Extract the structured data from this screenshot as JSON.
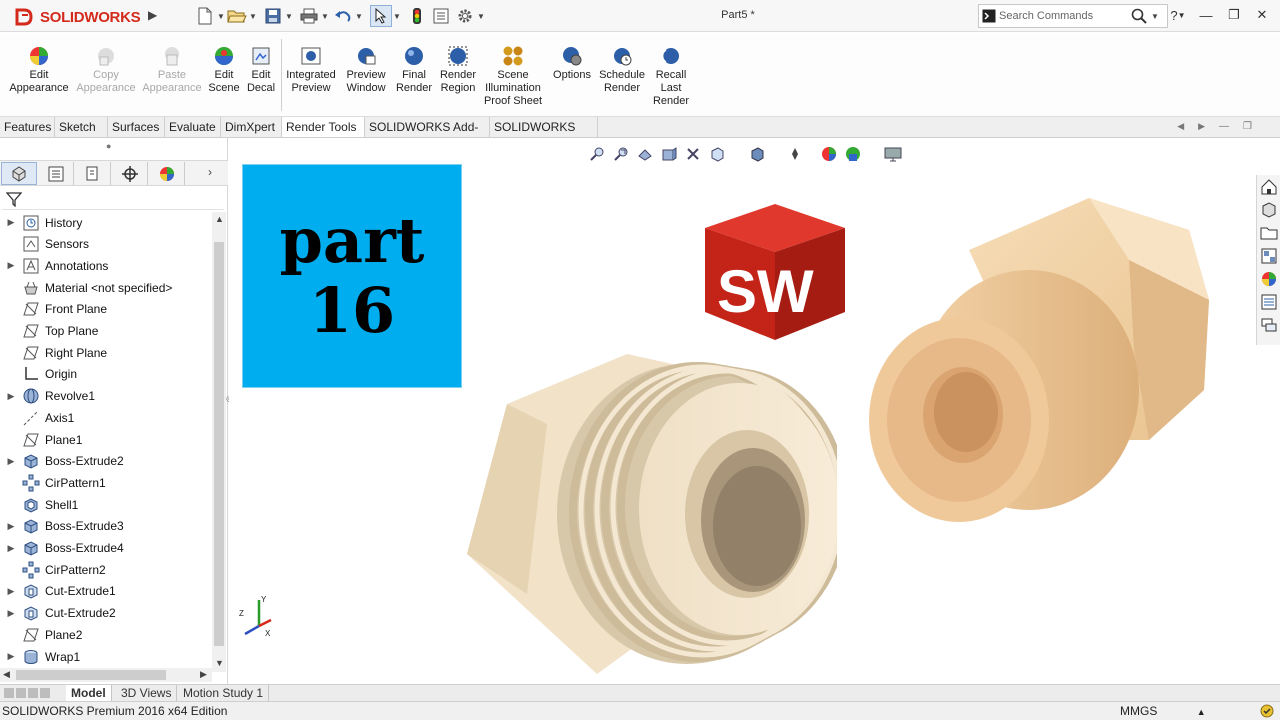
{
  "titlebar": {
    "app_name": "SOLIDWORKS",
    "doc_title": "Part5 *",
    "search_placeholder": "Search Commands",
    "help_label": "?",
    "min_label": "—",
    "restore_label": "❐",
    "close_label": "✕"
  },
  "commands": [
    {
      "l1": "Edit",
      "l2": "Appearance",
      "l3": "",
      "disabled": false
    },
    {
      "l1": "Copy",
      "l2": "Appearance",
      "l3": "",
      "disabled": true
    },
    {
      "l1": "Paste",
      "l2": "Appearance",
      "l3": "",
      "disabled": true
    },
    {
      "l1": "Edit",
      "l2": "Scene",
      "l3": "",
      "disabled": false
    },
    {
      "l1": "Edit",
      "l2": "Decal",
      "l3": "",
      "disabled": false
    },
    {
      "l1": "Integrated",
      "l2": "Preview",
      "l3": "",
      "disabled": false
    },
    {
      "l1": "Preview",
      "l2": "Window",
      "l3": "",
      "disabled": false
    },
    {
      "l1": "Final",
      "l2": "Render",
      "l3": "",
      "disabled": false
    },
    {
      "l1": "Render",
      "l2": "Region",
      "l3": "",
      "disabled": false
    },
    {
      "l1": "Scene",
      "l2": "Illumination",
      "l3": "Proof Sheet",
      "disabled": false
    },
    {
      "l1": "Options",
      "l2": "",
      "l3": "",
      "disabled": false
    },
    {
      "l1": "Schedule",
      "l2": "Render",
      "l3": "",
      "disabled": false
    },
    {
      "l1": "Recall",
      "l2": "Last",
      "l3": "Render",
      "disabled": false
    }
  ],
  "tabs": [
    "Features",
    "Sketch",
    "Surfaces",
    "Evaluate",
    "DimXpert",
    "Render Tools",
    "SOLIDWORKS Add-Ins",
    "SOLIDWORKS MBD"
  ],
  "active_tab": "Render Tools",
  "tree": [
    {
      "label": "History",
      "expand": "▶",
      "icon": "history-icon"
    },
    {
      "label": "Sensors",
      "expand": "",
      "icon": "sensors-icon"
    },
    {
      "label": "Annotations",
      "expand": "▶",
      "icon": "annotations-icon"
    },
    {
      "label": "Material <not specified>",
      "expand": "",
      "icon": "material-icon"
    },
    {
      "label": "Front Plane",
      "expand": "",
      "icon": "plane-icon"
    },
    {
      "label": "Top Plane",
      "expand": "",
      "icon": "plane-icon"
    },
    {
      "label": "Right Plane",
      "expand": "",
      "icon": "plane-icon"
    },
    {
      "label": "Origin",
      "expand": "",
      "icon": "origin-icon"
    },
    {
      "label": "Revolve1",
      "expand": "▶",
      "icon": "revolve-icon"
    },
    {
      "label": "Axis1",
      "expand": "",
      "icon": "axis-icon"
    },
    {
      "label": "Plane1",
      "expand": "",
      "icon": "plane-icon"
    },
    {
      "label": "Boss-Extrude2",
      "expand": "▶",
      "icon": "extrude-icon"
    },
    {
      "label": "CirPattern1",
      "expand": "",
      "icon": "pattern-icon"
    },
    {
      "label": "Shell1",
      "expand": "",
      "icon": "shell-icon"
    },
    {
      "label": "Boss-Extrude3",
      "expand": "▶",
      "icon": "extrude-icon"
    },
    {
      "label": "Boss-Extrude4",
      "expand": "▶",
      "icon": "extrude-icon"
    },
    {
      "label": "CirPattern2",
      "expand": "",
      "icon": "pattern-icon"
    },
    {
      "label": "Cut-Extrude1",
      "expand": "▶",
      "icon": "cut-icon"
    },
    {
      "label": "Cut-Extrude2",
      "expand": "▶",
      "icon": "cut-icon"
    },
    {
      "label": "Plane2",
      "expand": "",
      "icon": "plane-icon"
    },
    {
      "label": "Wrap1",
      "expand": "▶",
      "icon": "wrap-icon"
    }
  ],
  "bottom_tabs": [
    "Model",
    "3D Views",
    "Motion Study 1"
  ],
  "status": {
    "edition": "SOLIDWORKS Premium 2016 x64 Edition",
    "units": "MMGS",
    "units_caret": "▲"
  },
  "overlay": {
    "part_word": "part",
    "part_num": "16",
    "sw_letters": "SW"
  },
  "triad_labels": {
    "x": "X",
    "y": "Y",
    "z": "Z"
  },
  "colors": {
    "accent": "#00aeef",
    "brand_red": "#d42a1c",
    "part_tan": "#f0cfa6",
    "plastic": "#f2e4cc"
  }
}
